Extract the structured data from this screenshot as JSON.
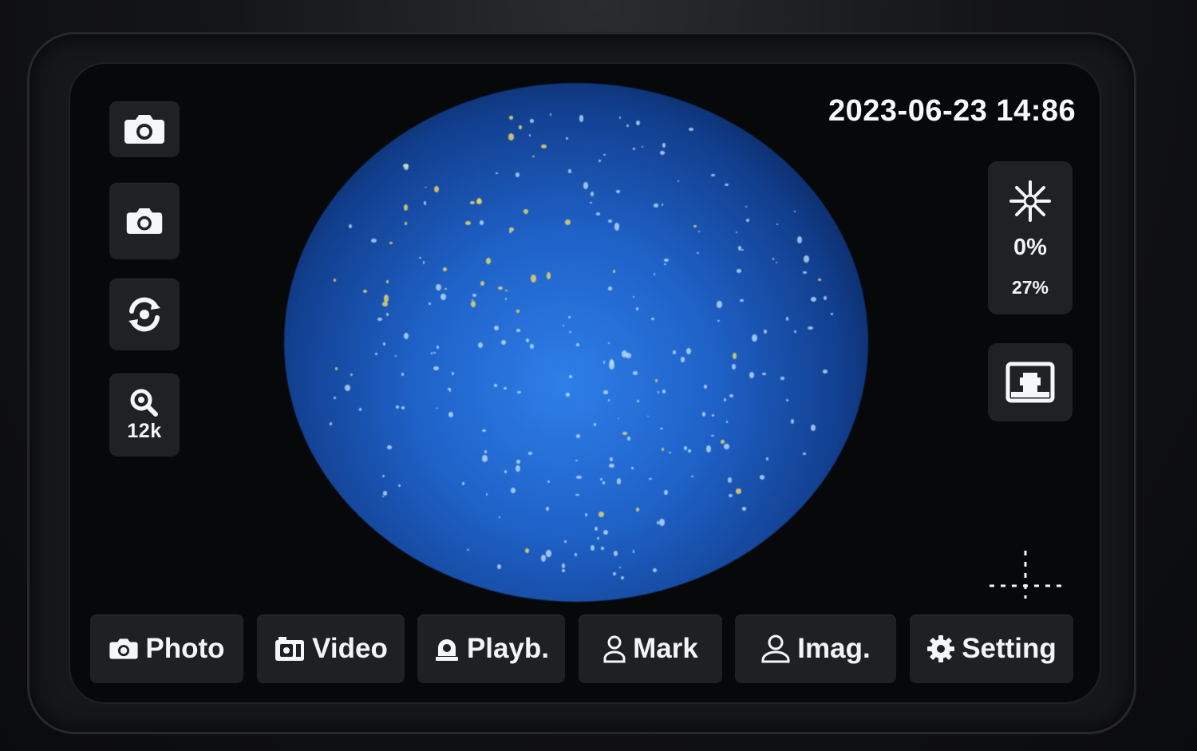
{
  "status": {
    "datetime": "2023-06-23 14:86"
  },
  "left_toolbar": {
    "zoom_label": "12k"
  },
  "right_panel": {
    "percent_primary": "0%",
    "percent_secondary": "27%"
  },
  "bottom_menu": [
    {
      "label": "Photo",
      "icon": "camera-icon"
    },
    {
      "label": "Video",
      "icon": "video-icon"
    },
    {
      "label": "Playb.",
      "icon": "playback-icon"
    },
    {
      "label": "Mark",
      "icon": "person-icon"
    },
    {
      "label": "Imag.",
      "icon": "user-icon"
    },
    {
      "label": "Setting",
      "icon": "gear-icon"
    }
  ],
  "colors": {
    "screen_bg": "#07080a",
    "button_bg": "#1f2124",
    "view_blue": "#1f62c8",
    "speck_yellow": "#e8d56a",
    "text": "#f2f4f6"
  }
}
